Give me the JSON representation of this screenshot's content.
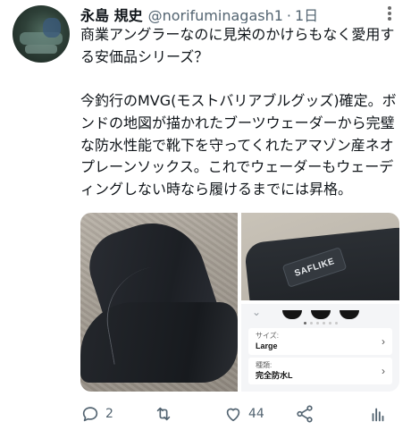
{
  "tweet": {
    "author_name": "永島 規史",
    "author_handle": "@norifuminagash1",
    "separator": "·",
    "time": "1日",
    "text": "商業アングラーなのに見栄のかけらもなく愛用する安価品シリーズ？\n\n今釣行のMVG(モストバリアブルグッズ)確定。ボンドの地図が描かれたブーツウェーダーから完璧な防水性能で靴下を守ってくれたアマゾン産ネオプレーンソックス。これでウェーダーもウェーディングしない時なら履けるまでには昇格。"
  },
  "media": {
    "logo_text": "SAFLIKE",
    "option_size_label": "サイズ:",
    "option_size_value": "Large",
    "option_color_label": "種類:",
    "option_color_value": "完全防水L"
  },
  "actions": {
    "reply_count": "2",
    "retweet_count": "",
    "like_count": "44",
    "share_icon": "share-icon",
    "analytics_icon": "analytics-icon"
  }
}
